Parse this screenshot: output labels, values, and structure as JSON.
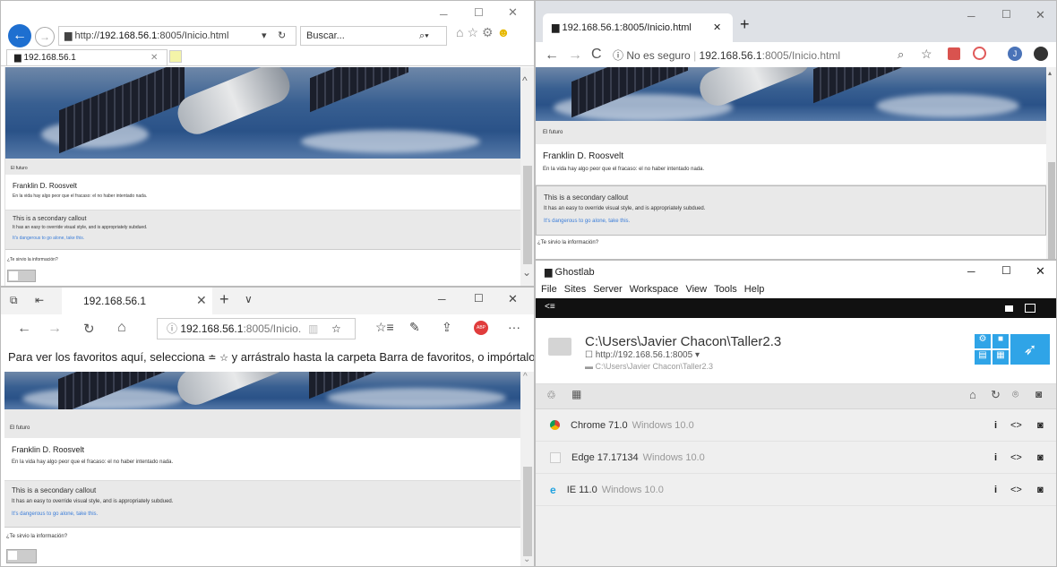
{
  "ie": {
    "url_prefix": "http://",
    "url_host": "192.168.56.1",
    "url_rest": ":8005/Inicio.html",
    "search": "Buscar...",
    "tab": "192.168.56.1"
  },
  "chrome": {
    "tab": "192.168.56.1:8005/Inicio.html",
    "not_secure": "No es seguro",
    "url_host": "192.168.56.1",
    "url_rest": ":8005/Inicio.html",
    "profile_letter": "J"
  },
  "edge": {
    "tab": "192.168.56.1",
    "url_host": "192.168.56.1",
    "url_rest": ":8005/Inicio.",
    "favorites_msg": "Para ver los favoritos aquí, selecciona",
    "favorites_msg2": "y arrástralo hasta la carpeta Barra de favoritos, o impórtalos"
  },
  "page": {
    "caption": "El futuro",
    "author": "Franklin D. Roosvelt",
    "quote": "En la vida hay algo peor que el fracaso: el no haber intentado nada.",
    "callout_title": "This is a secondary callout",
    "callout_text": "It has an easy to override visual style, and is appropriately subdued.",
    "callout_link": "It's dangerous to go alone, take this.",
    "question": "¿Te sirvio la información?"
  },
  "ghostlab": {
    "title": "Ghostlab",
    "menu": [
      "File",
      "Sites",
      "Server",
      "Workspace",
      "View",
      "Tools",
      "Help"
    ],
    "project_path": "C:\\Users\\Javier Chacon\\Taller2.3",
    "project_url": "http://192.168.56.1:8005",
    "project_folder": "C:\\Users\\Javier Chacon\\Taller2.3",
    "clients": [
      {
        "name": "Chrome 71.0",
        "os": "Windows 10.0",
        "icon": "chrome-icon"
      },
      {
        "name": "Edge 17.17134",
        "os": "Windows 10.0",
        "icon": "edge-icon"
      },
      {
        "name": "IE 11.0",
        "os": "Windows 10.0",
        "icon": "ie-icon"
      }
    ]
  }
}
